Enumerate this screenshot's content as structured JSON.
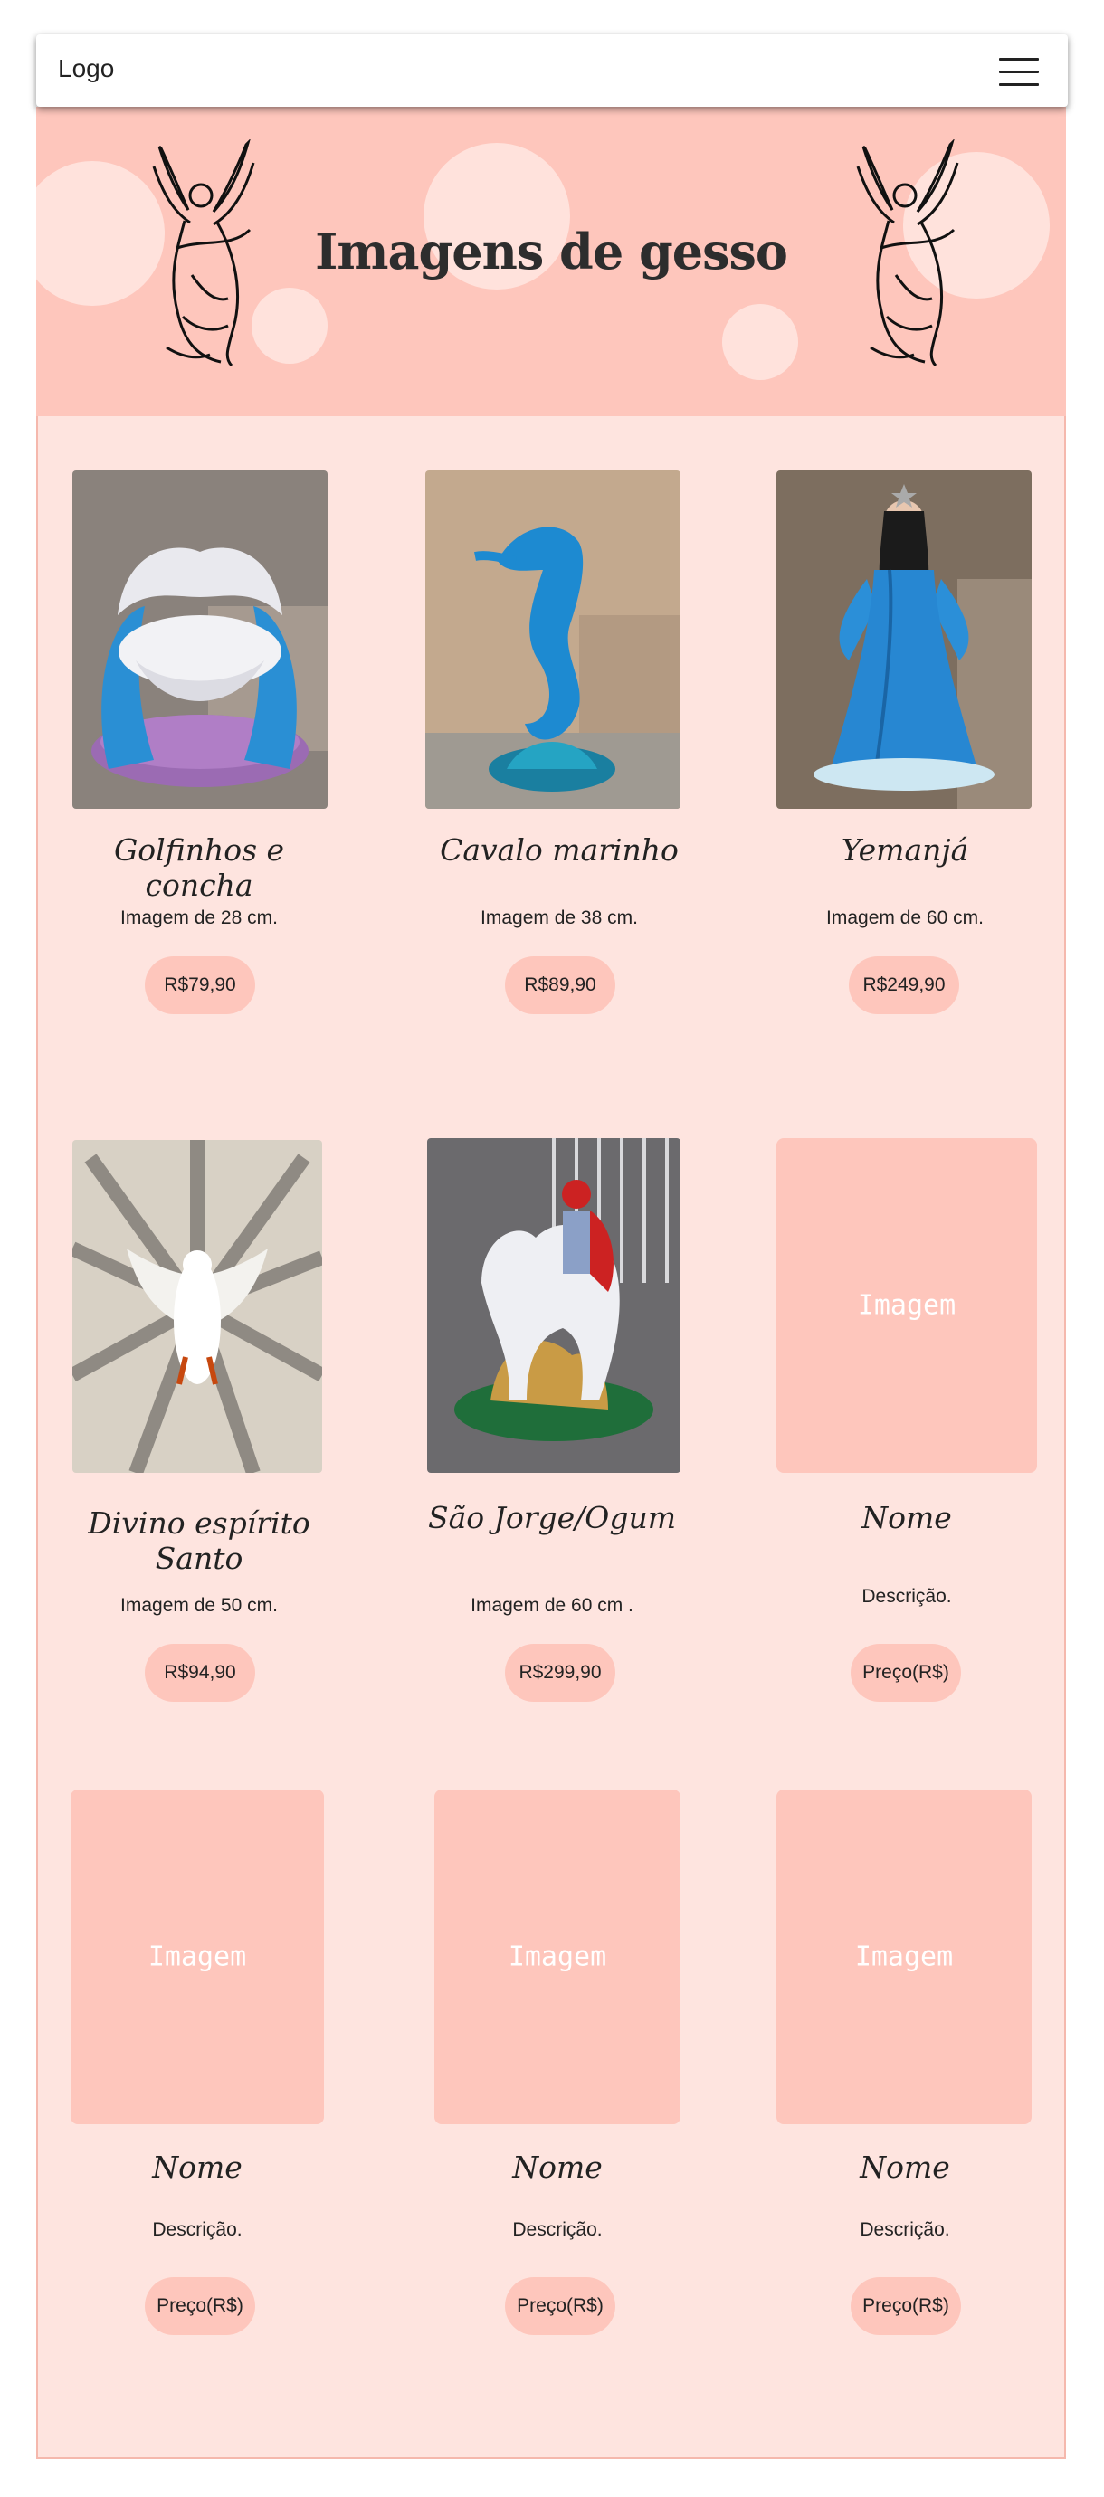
{
  "navbar": {
    "logo": "Logo",
    "menu_icon": "hamburger-menu-icon"
  },
  "hero": {
    "title": "Imagens de gesso",
    "decoration": "angel-illustration"
  },
  "products": [
    {
      "name": "Golfinhos e concha",
      "description": "Imagem de 28 cm.",
      "price": "R$79,90"
    },
    {
      "name": "Cavalo marinho",
      "description": "Imagem de 38 cm.",
      "price": "R$89,90"
    },
    {
      "name": "Yemanjá",
      "description": "Imagem de 60 cm.",
      "price": "R$249,90"
    },
    {
      "name": "Divino espírito Santo",
      "description": "Imagem de 50 cm.",
      "price": "R$94,90"
    },
    {
      "name": "São Jorge/Ogum",
      "description": "Imagem de 60 cm .",
      "price": "R$299,90"
    },
    {
      "name": "Nome",
      "description": "Descrição.",
      "price": "Preço(R$)",
      "image_placeholder": "Imagem"
    },
    {
      "name": "Nome",
      "description": "Descrição.",
      "price": "Preço(R$)",
      "image_placeholder": "Imagem"
    },
    {
      "name": "Nome",
      "description": "Descrição.",
      "price": "Preço(R$)",
      "image_placeholder": "Imagem"
    },
    {
      "name": "Nome",
      "description": "Descrição.",
      "price": "Preço(R$)",
      "image_placeholder": "Imagem"
    }
  ],
  "colors": {
    "accent": "#fec6bc",
    "background": "#fee4df",
    "text": "#222222"
  }
}
